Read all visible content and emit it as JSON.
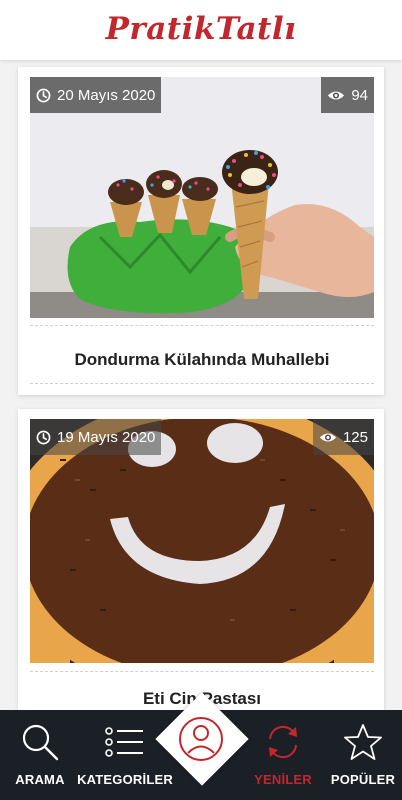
{
  "app": {
    "logo_text": "PratikTatlı",
    "brand_color": "#c1272d"
  },
  "posts": [
    {
      "date": "20 Mayıs 2020",
      "views": "94",
      "title": "Dondurma Külahında Muhallebi",
      "image_icon": "ice-cream-cone-photo"
    },
    {
      "date": "19 Mayıs 2020",
      "views": "125",
      "title": "Eti Cin Pastası",
      "image_icon": "smiley-tart-photo"
    }
  ],
  "nav": {
    "search": "ARAMA",
    "categories": "KATEGORİLER",
    "new": "YENİLER",
    "popular": "POPÜLER"
  }
}
